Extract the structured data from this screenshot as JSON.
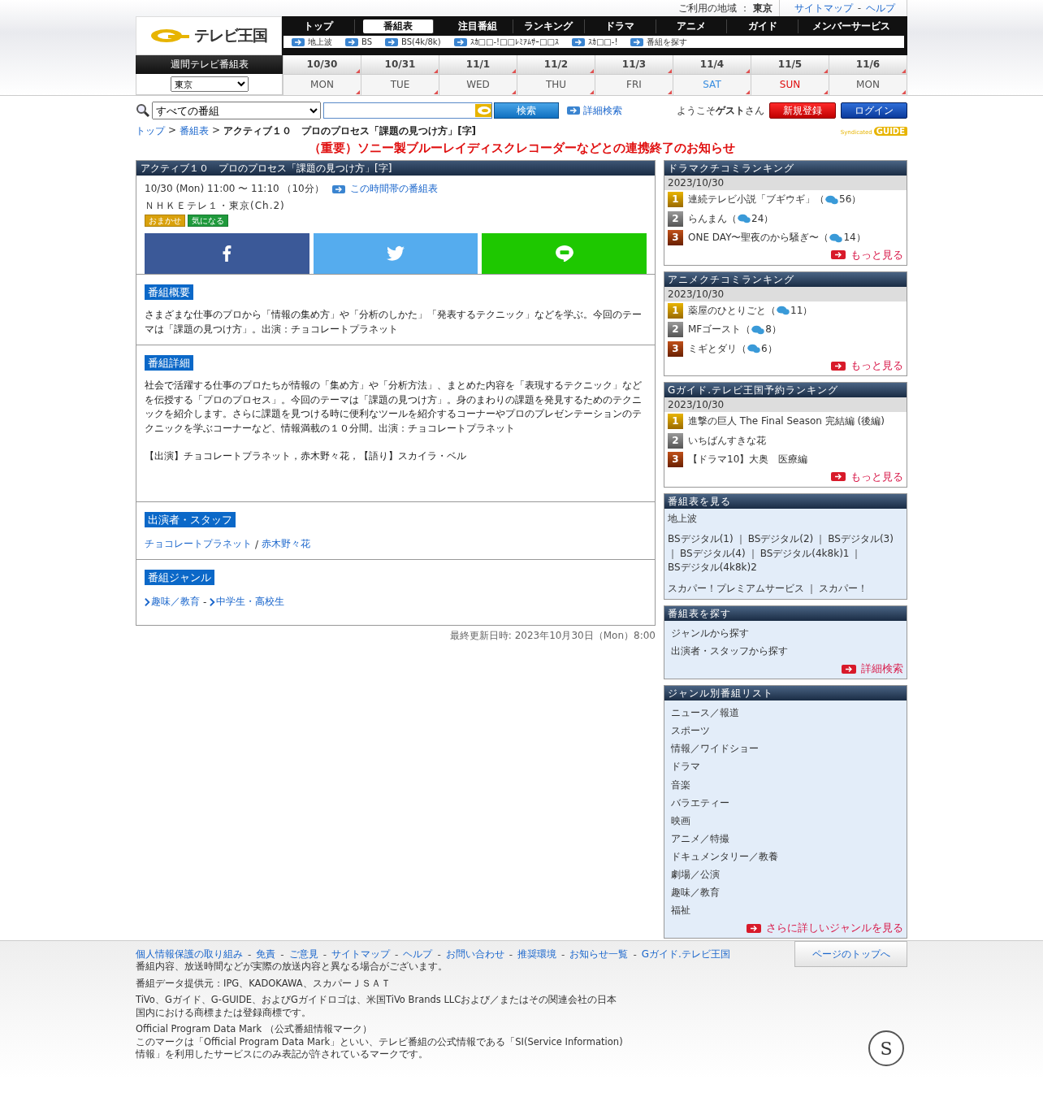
{
  "top_bar": {
    "region_label": "ご利用の地域 ：",
    "region": "東京",
    "links": [
      "サイトマップ",
      "ヘルプ"
    ],
    "separator": "-"
  },
  "logo": {
    "text": "テレビ王国"
  },
  "nav": {
    "tabs": [
      {
        "label": "トップ",
        "selected": false
      },
      {
        "label": "番組表",
        "selected": true
      },
      {
        "label": "注目番組",
        "selected": false
      },
      {
        "label": "ランキング",
        "selected": false
      },
      {
        "label": "ドラマ",
        "selected": false
      },
      {
        "label": "アニメ",
        "selected": false
      },
      {
        "label": "ガイド",
        "selected": false
      },
      {
        "label": "メンバーサービス",
        "selected": false
      }
    ],
    "sublinks": [
      "地上波",
      "BS",
      "BS(4k/8k)",
      "ｽｶ□□-!□□ﾚﾐｱﾑｻｰ□□ｽ",
      "ｽｶ□□-!",
      "番組を探す"
    ]
  },
  "weekly": {
    "title": "週間テレビ番組表",
    "region_select": "東京",
    "days": [
      {
        "date": "10/30",
        "weekday": "MON",
        "kind": "weekday"
      },
      {
        "date": "10/31",
        "weekday": "TUE",
        "kind": "weekday"
      },
      {
        "date": "11/1",
        "weekday": "WED",
        "kind": "weekday"
      },
      {
        "date": "11/2",
        "weekday": "THU",
        "kind": "weekday"
      },
      {
        "date": "11/3",
        "weekday": "FRI",
        "kind": "weekday"
      },
      {
        "date": "11/4",
        "weekday": "SAT",
        "kind": "saturday"
      },
      {
        "date": "11/5",
        "weekday": "SUN",
        "kind": "sunday"
      },
      {
        "date": "11/6",
        "weekday": "MON",
        "kind": "weekday"
      }
    ]
  },
  "search": {
    "category": "すべての番組",
    "button": "検索",
    "advanced": "詳細検索"
  },
  "account": {
    "welcome": "ようこそ**ゲスト**さん",
    "register": "新規登録",
    "login": "ログイン"
  },
  "syndicated_logo": {
    "text": "Syndicated",
    "mark": "GUIDE"
  },
  "breadcrumb": {
    "links": [
      "トップ",
      "番組表"
    ],
    "separator": ">",
    "current": "アクティブ１０　プロのプロセス「課題の見つけ方」[字]"
  },
  "notice": "（重要）ソニー製ブルーレイディスクレコーダーなどとの連携終了のお知らせ",
  "program": {
    "title": "アクティブ１０　プロのプロセス「課題の見つけ方」[字]",
    "time": "10/30 (Mon) 11:00 〜 11:10 （10分）",
    "schedule_link": "この時間帯の番組表",
    "channel": "ＮＨＫＥテレ１・東京(Ch.2)",
    "tags": [
      {
        "label": "おまかせ",
        "color": "#d9a10c"
      },
      {
        "label": "気になる",
        "color": "#1f9a3c"
      }
    ],
    "share": [
      {
        "kind": "facebook"
      },
      {
        "kind": "twitter"
      },
      {
        "kind": "line"
      }
    ],
    "summary": {
      "heading": "番組概要",
      "text": "さまざまな仕事のプロから「情報の集め方」や「分析のしかた」「発表するテクニック」などを学ぶ。今回のテーマは「課題の見つけ方」。出演：チョコレートプラネット"
    },
    "detail": {
      "heading": "番組詳細",
      "paragraphs": [
        "社会で活躍する仕事のプロたちが情報の「集め方」や「分析方法」、まとめた内容を「表現するテクニック」などを伝授する「プロのプロセス」。今回のテーマは「課題の見つけ方」。身のまわりの課題を発見するためのテクニックを紹介します。さらに課題を見つける時に便利なツールを紹介するコーナーやプロのプレゼンテーションのテクニックを学ぶコーナーなど、情報満載の１０分間。出演：チョコレートプラネット",
        "【出演】チョコレートプラネット，赤木野々花，【語り】スカイラ・ベル"
      ]
    },
    "cast": {
      "heading": "出演者・スタッフ",
      "links": [
        "チョコレートプラネット",
        "赤木野々花"
      ],
      "separator": "/"
    },
    "genre": {
      "heading": "番組ジャンル",
      "links": [
        "趣味／教育",
        "中学生・高校生"
      ],
      "separator": "-"
    }
  },
  "updated": "最終更新日時: 2023年10月30日（Mon）8:00",
  "sidebar": {
    "rankings": [
      {
        "title": "ドラマクチコミランキング",
        "date": "2023/10/30",
        "more": "もっと見る",
        "items": [
          {
            "rank": "1",
            "title": "連続テレビ小説「ブギウギ」（",
            "comments": "56）"
          },
          {
            "rank": "2",
            "title": "らんまん（",
            "comments": "24）"
          },
          {
            "rank": "3",
            "title": "ONE DAY〜聖夜のから騒ぎ〜（",
            "comments": "14）"
          }
        ]
      },
      {
        "title": "アニメクチコミランキング",
        "date": "2023/10/30",
        "more": "もっと見る",
        "items": [
          {
            "rank": "1",
            "title": "薬屋のひとりごと（",
            "comments": "11）"
          },
          {
            "rank": "2",
            "title": "MFゴースト（",
            "comments": "8）"
          },
          {
            "rank": "3",
            "title": "ミギとダリ（",
            "comments": "6）"
          }
        ]
      },
      {
        "title": "Gガイド.テレビ王国予約ランキング",
        "date": "2023/10/30",
        "more": "もっと見る",
        "items": [
          {
            "rank": "1",
            "title": "進撃の巨人 The Final Season 完結編 (後編)"
          },
          {
            "rank": "2",
            "title": "いちばんすきな花"
          },
          {
            "rank": "3",
            "title": "【ドラマ10】大奥　医療編"
          }
        ]
      }
    ],
    "browse": {
      "title": "番組表を見る",
      "separator": "｜",
      "groups": [
        {
          "links": [
            "地上波"
          ]
        },
        {
          "links": [
            "BSデジタル(1)",
            "BSデジタル(2)",
            "BSデジタル(3)",
            "BSデジタル(4)",
            "BSデジタル(4k8k)1",
            "BSデジタル(4k8k)2"
          ]
        },
        {
          "links": [
            "スカパー！プレミアムサービス",
            "スカパー！"
          ]
        }
      ]
    },
    "find": {
      "title": "番組表を探す",
      "links": [
        "ジャンルから探す",
        "出演者・スタッフから探す"
      ],
      "more": "詳細検索"
    },
    "genres": {
      "title": "ジャンル別番組リスト",
      "links": [
        "ニュース／報道",
        "スポーツ",
        "情報／ワイドショー",
        "ドラマ",
        "音楽",
        "バラエティー",
        "映画",
        "アニメ／特撮",
        "ドキュメンタリー／教養",
        "劇場／公演",
        "趣味／教育",
        "福祉"
      ],
      "more": "さらに詳しいジャンルを見る"
    }
  },
  "footer": {
    "links": [
      "個人情報保護の取り組み",
      "免責",
      "ご意見",
      "サイトマップ",
      "ヘルプ",
      "お問い合わせ",
      "推奨環境",
      "お知らせ一覧",
      "Gガイド.テレビ王国"
    ],
    "separator": "-",
    "page_top": "ページのトップへ",
    "notes": [
      "番組内容、放送時間などが実際の放送内容と異なる場合がございます。",
      "番組データ提供元：IPG、KADOKAWA、スカパーＪＳＡＴ",
      "TiVo、Gガイド、G-GUIDE、およびGガイドロゴは、米国TiVo Brands LLCおよび／またはその関連会社の日本国内における商標または登録商標です。",
      "Official Program Data Mark （公式番組情報マーク）",
      "このマークは「Official Program Data Mark」といい、テレビ番組の公式情報である「SI(Service Information) 情報」を利用したサービスにのみ表記が許されているマークです。"
    ],
    "mark_letter": "S"
  }
}
